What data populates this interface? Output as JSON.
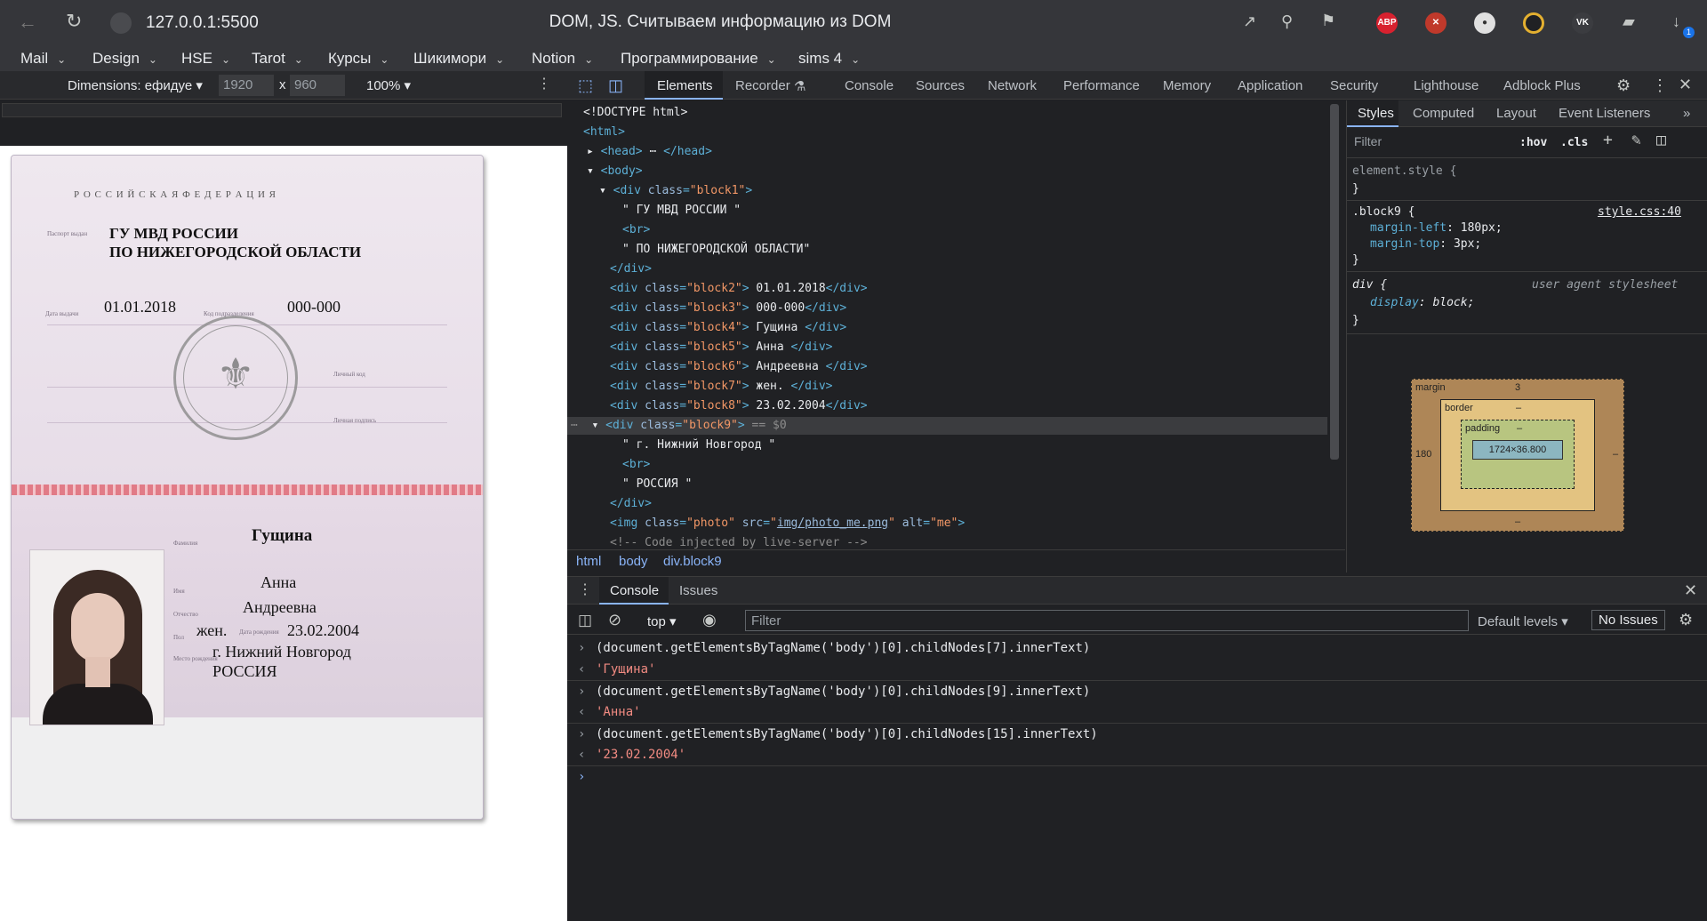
{
  "browser": {
    "url": "127.0.0.1:5500",
    "title": "DOM, JS. Считываем информацию из DOM",
    "ext_abp": "ABP",
    "download_badge": "1"
  },
  "bookmarks": [
    "Mail",
    "Design",
    "HSE",
    "Tarot",
    "Курсы",
    "Шикимори",
    "Notion",
    "Программирование",
    "sims 4"
  ],
  "device_toolbar": {
    "dimensions_label": "Dimensions: ефидуе",
    "width": "1920",
    "height": "960",
    "times": "x",
    "zoom": "100%"
  },
  "passport": {
    "country": "Р О С С И Й С К А Я     Ф Е Д Е Р А Ц И Я",
    "issued_by_1": "ГУ МВД РОССИИ",
    "issued_by_2": "ПО НИЖЕГОРОДСКОЙ ОБЛАСТИ",
    "issue_date": "01.01.2018",
    "dept_code": "000-000",
    "surname": "Гущина",
    "name": "Анна",
    "patronymic": "Андреевна",
    "sex": "жен.",
    "birth_date": "23.02.2004",
    "birth_place_1": "г. Нижний Новгород",
    "birth_place_2": "РОССИЯ",
    "lbl_issued": "Паспорт выдан",
    "lbl_date": "Дата выдачи",
    "lbl_code": "Код подразделения",
    "lbl_sign": "Личный код",
    "lbl_sign2": "Личная подпись",
    "lbl_surname": "Фамилия",
    "lbl_name": "Имя",
    "lbl_patr": "Отчество",
    "lbl_sex": "Пол",
    "lbl_bdate": "Дата рождения",
    "lbl_bplace": "Место рождения"
  },
  "devtools": {
    "tabs": [
      "Elements",
      "Recorder",
      "Console",
      "Sources",
      "Network",
      "Performance",
      "Memory",
      "Application",
      "Security",
      "Lighthouse",
      "Adblock Plus"
    ],
    "active_tab": "Elements",
    "breadcrumbs": [
      "html",
      "body",
      "div.block9"
    ],
    "styles_tabs": [
      "Styles",
      "Computed",
      "Layout",
      "Event Listeners"
    ],
    "filter_placeholder": "Filter",
    "hov": ":hov",
    "cls": ".cls",
    "styles": {
      "element_style": "element.style {",
      "close": "}",
      "rule_selector": ".block9 {",
      "rule_source": "style.css:40",
      "prop1_name": "margin-left",
      "prop1_value": "180px;",
      "prop2_name": "margin-top",
      "prop2_value": "3px;",
      "ua_selector": "div {",
      "ua_source": "user agent stylesheet",
      "ua_prop_name": "display",
      "ua_prop_value": "block;"
    },
    "box_model": {
      "margin_label": "margin",
      "margin_top": "3",
      "margin_left": "180",
      "margin_right": "–",
      "margin_bottom": "–",
      "border_label": "border",
      "border_val": "–",
      "padding_label": "padding",
      "padding_val": "–",
      "content": "1724×36.800"
    }
  },
  "console": {
    "tabs": [
      "Console",
      "Issues"
    ],
    "context": "top",
    "filter_placeholder": "Filter",
    "levels": "Default levels",
    "issues": "No Issues",
    "entries": [
      {
        "input": "(document.getElementsByTagName('body')[0].childNodes[7].innerText)",
        "output": "'Гущина'"
      },
      {
        "input": "(document.getElementsByTagName('body')[0].childNodes[9].innerText)",
        "output": "'Анна'"
      },
      {
        "input": "(document.getElementsByTagName('body')[0].childNodes[15].innerText)",
        "output": "'23.02.2004'"
      }
    ]
  }
}
